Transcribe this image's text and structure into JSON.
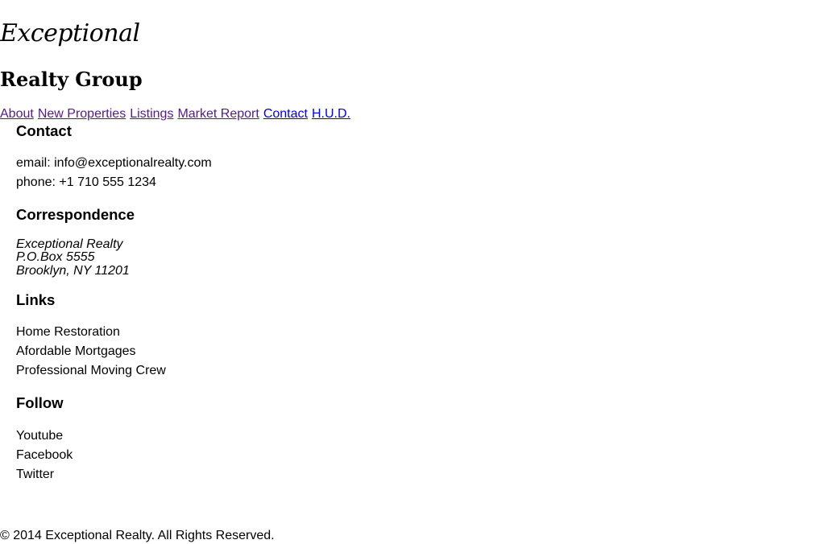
{
  "header": {
    "brand_script": "Exceptional",
    "brand_group": "Realty Group"
  },
  "nav": {
    "items": [
      {
        "label": "About"
      },
      {
        "label": "New Properties"
      },
      {
        "label": "Listings"
      },
      {
        "label": "Market Report"
      },
      {
        "label": "Contact"
      },
      {
        "label": "H.U.D."
      }
    ],
    "colors": {
      "visited": "#551a8b",
      "unvisited": "#0000ee"
    }
  },
  "contact": {
    "title": "Contact",
    "email": "email: info@exceptionalrealty.com",
    "phone": "phone: +1 710 555 1234"
  },
  "correspondence": {
    "title": "Correspondence",
    "lines": [
      "Exceptional Realty",
      "P.O.Box 5555",
      "Brooklyn, NY 11201"
    ]
  },
  "links": {
    "title": "Links",
    "items": [
      "Home Restoration",
      "Afordable Mortgages",
      "Professional Moving Crew"
    ]
  },
  "follow": {
    "title": "Follow",
    "items": [
      "Youtube",
      "Facebook",
      "Twitter"
    ]
  },
  "footer": {
    "copyright": "© 2014 Exceptional Realty. All Rights Reserved."
  }
}
